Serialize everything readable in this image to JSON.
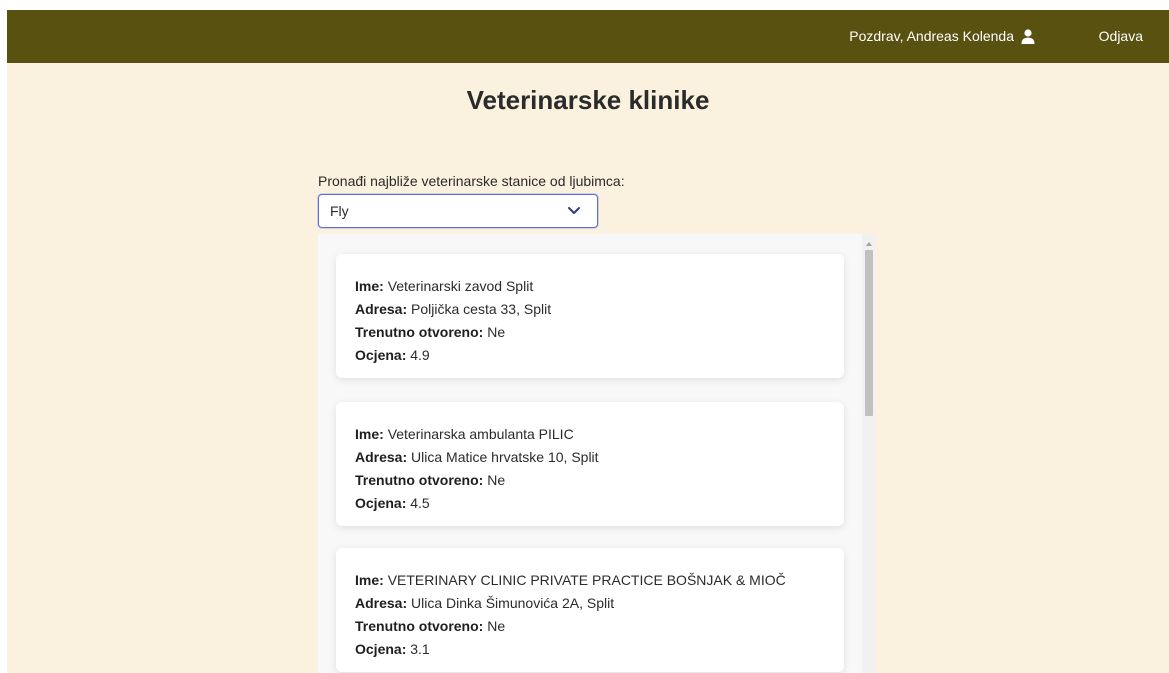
{
  "header": {
    "greeting": "Pozdrav, Andreas Kolenda",
    "user_icon": "user-icon",
    "logout": "Odjava",
    "bg_color": "#585110"
  },
  "main": {
    "title": "Veterinarske klinike",
    "select_label": "Pronađi najbliže veterinarske stanice od ljubimca:",
    "selected_pet": "Fly",
    "background": "#fbf1df"
  },
  "field_labels": {
    "name": "Ime:",
    "address": "Adresa:",
    "open_now": "Trenutno otvoreno:",
    "rating": "Ocjena:"
  },
  "clinics": [
    {
      "name": "Veterinarski zavod Split",
      "address": "Poljička cesta 33, Split",
      "open_now": "Ne",
      "rating": "4.9"
    },
    {
      "name": "Veterinarska ambulanta PILIC",
      "address": "Ulica Matice hrvatske 10, Split",
      "open_now": "Ne",
      "rating": "4.5"
    },
    {
      "name": "VETERINARY CLINIC PRIVATE PRACTICE BOŠNJAK & MIOČ",
      "address": "Ulica Dinka Šimunovića 2A, Split",
      "open_now": "Ne",
      "rating": "3.1"
    }
  ]
}
